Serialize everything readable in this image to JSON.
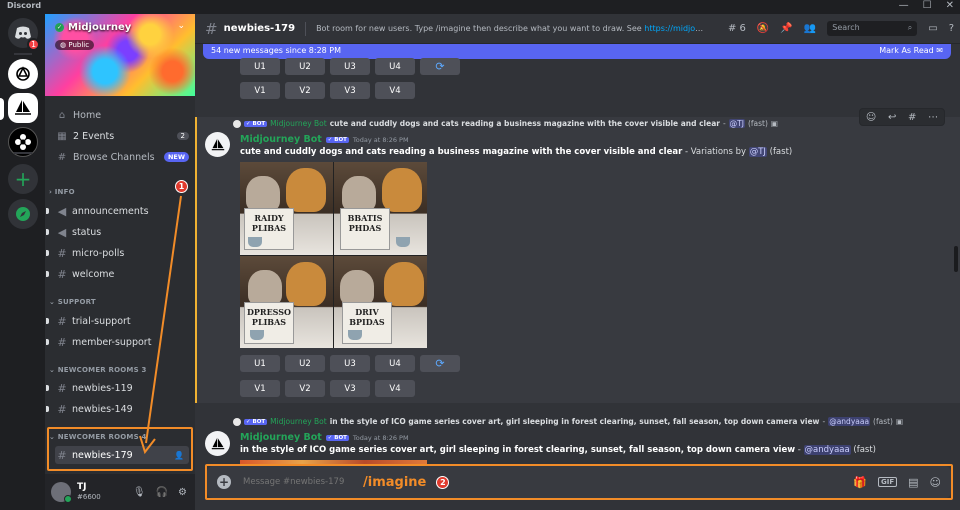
{
  "window": {
    "title": "Discord",
    "controls": [
      "—",
      "☐",
      "✕"
    ]
  },
  "rail": {
    "home_badge": "1"
  },
  "server": {
    "name": "Midjourney",
    "visibility": "Public"
  },
  "nav": {
    "home": "Home",
    "events": "2 Events",
    "events_count": "2",
    "browse": "Browse Channels",
    "browse_badge": "NEW"
  },
  "categories": {
    "info": "INFO",
    "support": "SUPPORT",
    "newcomer3": "NEWCOMER ROOMS 3",
    "newcomer4": "NEWCOMER ROOMS 4"
  },
  "channels": {
    "info": [
      "announcements",
      "status",
      "micro-polls",
      "welcome"
    ],
    "support": [
      "trial-support",
      "member-support"
    ],
    "newcomer3": [
      "newbies-119",
      "newbies-149"
    ],
    "newcomer4": [
      "newbies-179"
    ]
  },
  "markers": {
    "one": "1",
    "two": "2"
  },
  "user": {
    "name": "TJ",
    "tag": "#6600"
  },
  "header": {
    "channel": "newbies-179",
    "topic": "Bot room for new users. Type /imagine then describe what you want to draw. See ",
    "topic_link": "https://midjourney.gitb...",
    "threads_count": "6",
    "search_placeholder": "Search"
  },
  "newbar": {
    "text": "54 new messages since 8:28 PM",
    "action": "Mark As Read"
  },
  "buttons": {
    "u": [
      "U1",
      "U2",
      "U3",
      "U4"
    ],
    "v": [
      "V1",
      "V2",
      "V3",
      "V4"
    ]
  },
  "messages": [
    {
      "reply_bot_badge": "BOT",
      "reply_author": "Midjourney Bot",
      "reply_prompt": "cute and cuddly dogs and cats reading a business magazine with the cover visible and clear",
      "reply_sep": " - ",
      "reply_mention": "@TJ",
      "reply_mode": "(fast)",
      "author": "Midjourney Bot",
      "bot_badge": "BOT",
      "time": "Today at 8:26 PM",
      "prompt": "cute and cuddly dogs and cats reading a business magazine with the cover visible and clear",
      "suffix": " - Variations by ",
      "mention": "@TJ",
      "mode": " (fast)",
      "tile_texts": [
        "RAIDY",
        "BBATIS",
        "DPRESSO",
        "DRIV"
      ],
      "papers": [
        "PLIBAS",
        "PHDAS",
        "PLIBAS",
        "BPIDAS"
      ]
    },
    {
      "reply_bot_badge": "BOT",
      "reply_author": "Midjourney Bot",
      "reply_prompt": "in the style of ICO game series cover art, girl sleeping in forest clearing, sunset, fall season, top down camera view",
      "reply_sep": " - ",
      "reply_mention": "@andyaaa",
      "reply_mode": "(fast)",
      "author": "Midjourney Bot",
      "bot_badge": "BOT",
      "time": "Today at 8:26 PM",
      "prompt": "in the style of ICO game series cover art, girl sleeping in forest clearing, sunset, fall season, top down camera view",
      "suffix": " - ",
      "mention": "@andyaaa",
      "mode": " (fast)"
    }
  ],
  "composer": {
    "placeholder": "Message #newbies-179",
    "command": "/imagine",
    "gif": "GIF"
  },
  "colors": {
    "accent": "#5865f2",
    "highlight": "#f28c28",
    "bot_green": "#23a559",
    "marker_red": "#e03b2e"
  }
}
